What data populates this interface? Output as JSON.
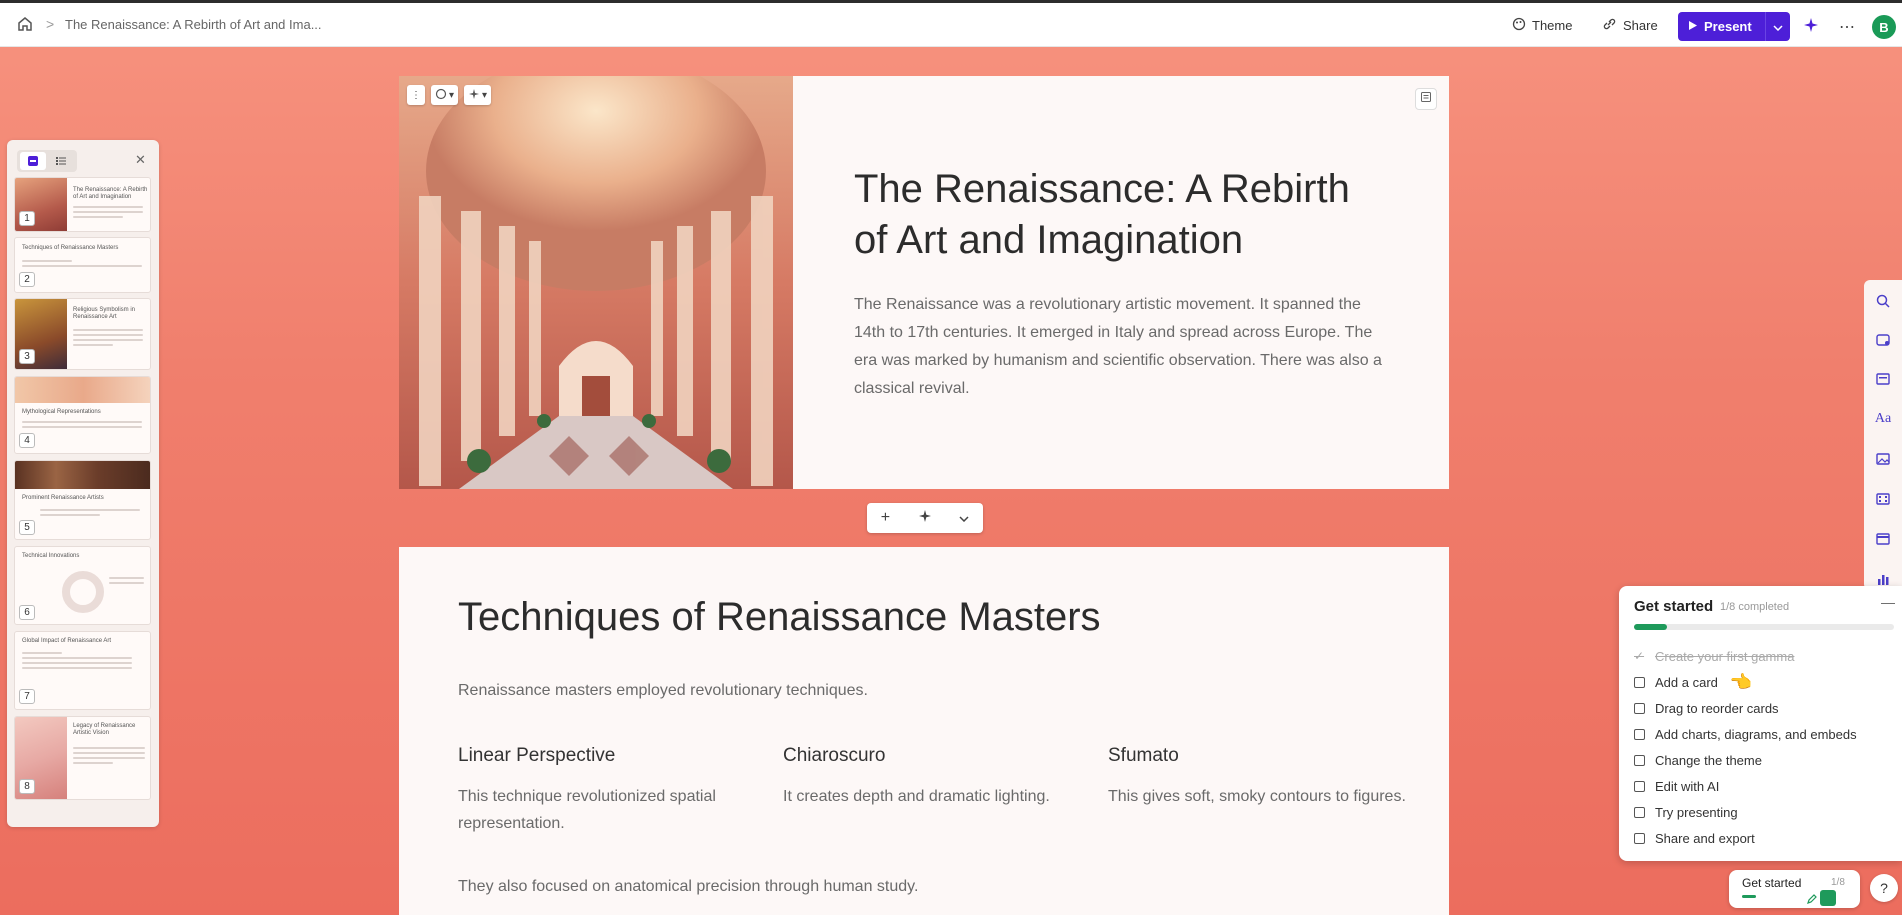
{
  "topbar": {
    "breadcrumb_sep": ">",
    "doc_title": "The Renaissance: A Rebirth of Art and Ima...",
    "theme_label": "Theme",
    "share_label": "Share",
    "present_label": "Present",
    "avatar_initial": "B"
  },
  "thumbnails": [
    {
      "num": "1",
      "title": "The Renaissance: A Rebirth of Art and Imagination"
    },
    {
      "num": "2",
      "title": "Techniques of Renaissance Masters"
    },
    {
      "num": "3",
      "title": "Religious Symbolism in Renaissance Art"
    },
    {
      "num": "4",
      "title": "Mythological Representations"
    },
    {
      "num": "5",
      "title": "Prominent Renaissance Artists"
    },
    {
      "num": "6",
      "title": "Technical Innovations"
    },
    {
      "num": "7",
      "title": "Global Impact of Renaissance Art"
    },
    {
      "num": "8",
      "title": "Legacy of Renaissance Artistic Vision"
    }
  ],
  "card1": {
    "title": "The Renaissance: A Rebirth of Art and Imagination",
    "body": "The Renaissance was a revolutionary artistic movement. It spanned the 14th to 17th centuries. It emerged in Italy and spread across Europe. The era was marked by humanism and scientific observation. There was also a classical revival."
  },
  "card2": {
    "title": "Techniques of Renaissance Masters",
    "intro": "Renaissance masters employed revolutionary techniques.",
    "columns": [
      {
        "heading": "Linear Perspective",
        "text": "This technique revolutionized spatial representation."
      },
      {
        "heading": "Chiaroscuro",
        "text": "It creates depth and dramatic lighting."
      },
      {
        "heading": "Sfumato",
        "text": "This gives soft, smoky contours to figures."
      }
    ],
    "outro": "They also focused on anatomical precision through human study."
  },
  "get_started": {
    "title": "Get started",
    "count": "1/8 completed",
    "progress": 0.125,
    "items": [
      {
        "label": "Create your first gamma",
        "done": true
      },
      {
        "label": "Add a card",
        "done": false
      },
      {
        "label": "Drag to reorder cards",
        "done": false
      },
      {
        "label": "Add charts, diagrams, and embeds",
        "done": false
      },
      {
        "label": "Change the theme",
        "done": false
      },
      {
        "label": "Edit with AI",
        "done": false
      },
      {
        "label": "Try presenting",
        "done": false
      },
      {
        "label": "Share and export",
        "done": false
      }
    ],
    "mini_label": "Get started",
    "mini_count": "1/8"
  },
  "help_label": "?",
  "colors": {
    "accent": "#4d1fd8",
    "success": "#1e9a5b",
    "background": "#f07f6d"
  }
}
